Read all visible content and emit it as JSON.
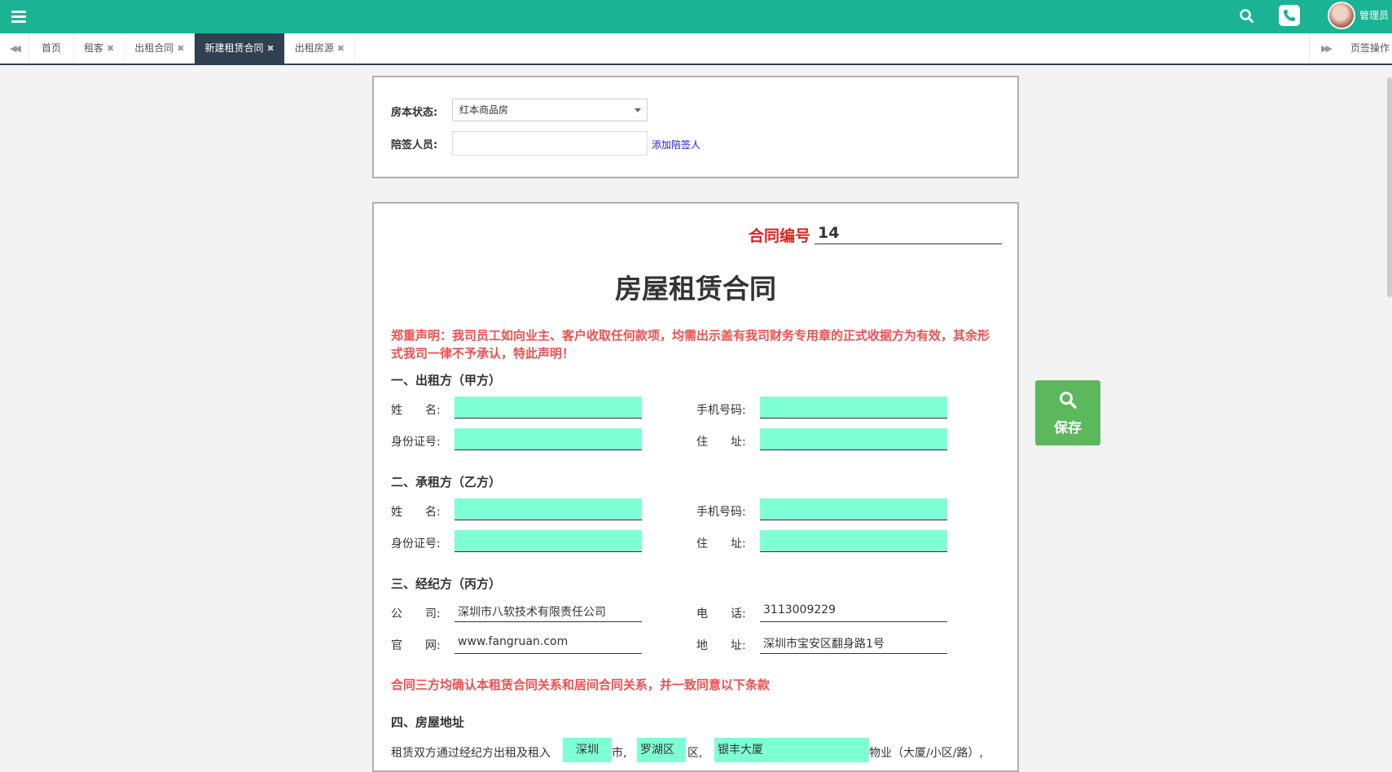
{
  "header": {
    "username": "管理员",
    "icons": [
      "menu-icon",
      "search-icon",
      "phone-icon",
      "avatar"
    ]
  },
  "tabs": {
    "items": [
      {
        "label": "首页",
        "closable": false
      },
      {
        "label": "租客",
        "closable": true
      },
      {
        "label": "出租合同",
        "closable": true
      },
      {
        "label": "新建租赁合同",
        "closable": true,
        "active": true
      },
      {
        "label": "出租房源",
        "closable": true
      }
    ],
    "close_glyph": "✖",
    "page_ops": "页签操作"
  },
  "form": {
    "status_label": "房本状态:",
    "status_value": "红本商品房",
    "witness_label": "陪签人员:",
    "witness_value": "",
    "add_witness": "添加陪签人"
  },
  "contract": {
    "number_label": "合同编号",
    "number_value": "14",
    "title": "房屋租赁合同",
    "notice": "郑重声明：我司员工如向业主、客户收取任何款项，均需出示盖有我司财务专用章的正式收据方为有效，其余形式我司一律不予承认，特此声明！",
    "party_a": {
      "title": "一、出租方（甲方）",
      "name_label": "姓　　名:",
      "phone_label": "手机号码:",
      "id_label": "身份证号:",
      "address_label": "住　　址:",
      "name": "",
      "phone": "",
      "id": "",
      "address": ""
    },
    "party_b": {
      "title": "二、承租方（乙方）",
      "name_label": "姓　　名:",
      "phone_label": "手机号码:",
      "id_label": "身份证号:",
      "address_label": "住　　址:",
      "name": "",
      "phone": "",
      "id": "",
      "address": ""
    },
    "party_c": {
      "title": "三、经纪方（丙方）",
      "company_label": "公　　司:",
      "company": "深圳市八软技术有限责任公司",
      "tel_label": "电　　话:",
      "tel": "3113009229",
      "website_label": "官　　网:",
      "website": "www.fangruan.com",
      "address_label": "地　　址:",
      "address": "深圳市宝安区翻身路1号"
    },
    "confirm": "合同三方均确认本租赁合同关系和居间合同关系，并一致同意以下条款",
    "house": {
      "title": "四、房屋地址",
      "lead": "租赁双方通过经纪方出租及租入",
      "city": "深圳",
      "city_unit": "市,",
      "district": "罗湖区",
      "district_unit": "区,",
      "building": "银丰大厦",
      "tail": "物业（大厦/小区/路）,"
    }
  },
  "save_button": {
    "label": "保存",
    "color": "#5cb85c"
  },
  "colors": {
    "topbar": "#1ab394",
    "active_tab": "#2f4050",
    "field_fill": "#7fffd4",
    "red": "#ee4f4f"
  }
}
